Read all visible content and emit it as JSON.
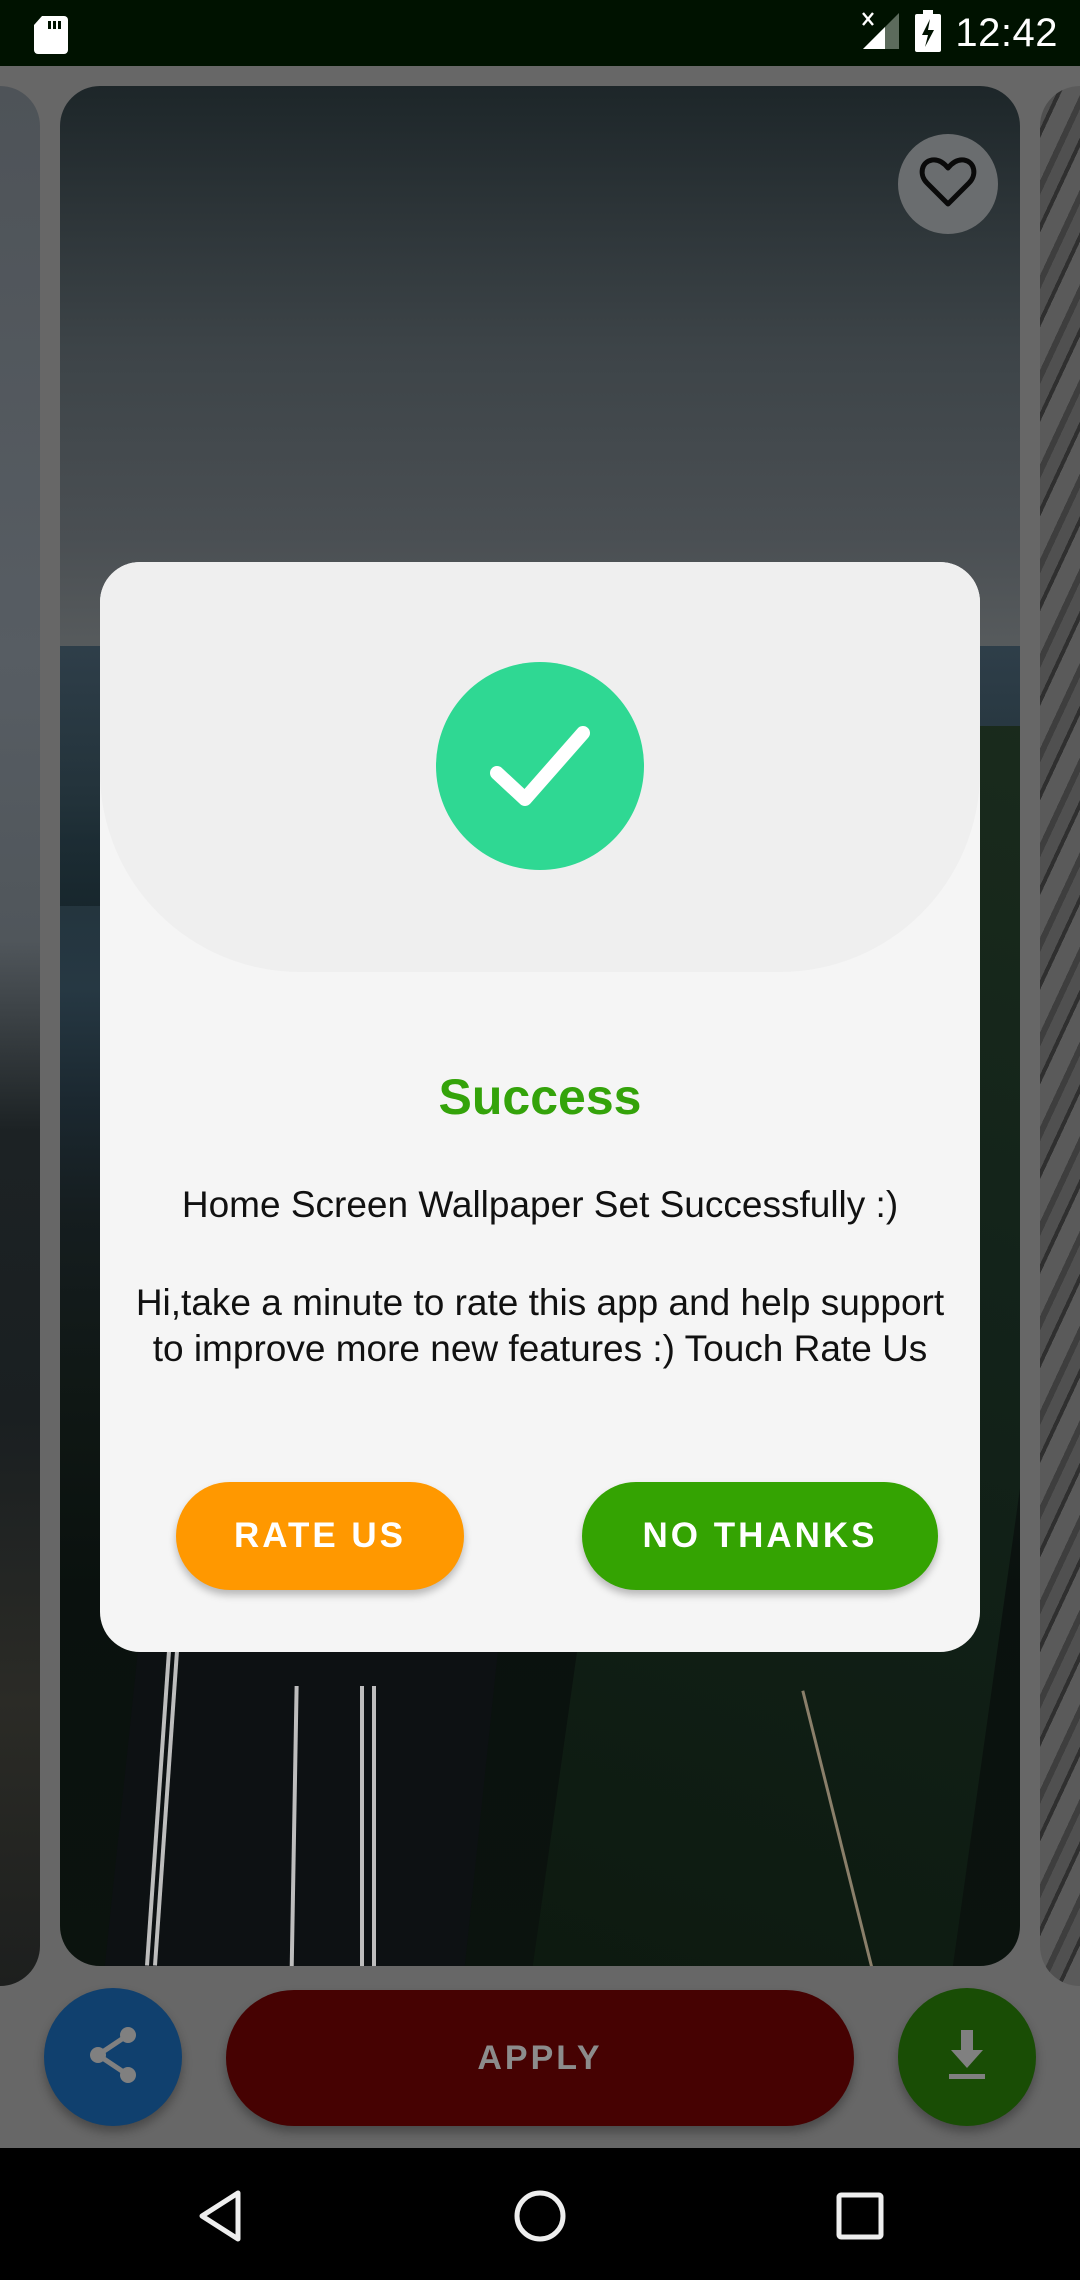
{
  "status_bar": {
    "time": "12:42",
    "icons": [
      "sd-card-icon",
      "signal-no-service-icon",
      "battery-charging-icon"
    ]
  },
  "wallpaper_card": {
    "favorite_icon": "heart-outline-icon"
  },
  "actions": {
    "share_icon": "share-icon",
    "apply_label": "APPLY",
    "download_icon": "download-icon"
  },
  "dialog": {
    "icon": "check-circle-icon",
    "title": "Success",
    "message": "Home Screen Wallpaper Set Successfully :)",
    "prompt": "Hi,take a minute to rate this app and help support to improve more new features :) Touch Rate Us",
    "rate_button": "RATE US",
    "no_thanks_button": "NO THANKS",
    "colors": {
      "title": "#34a30a",
      "icon_bg": "#2fd893",
      "rate_button": "#ff9800",
      "no_thanks_button": "#34a302"
    }
  },
  "nav_bar": {
    "back": "back-icon",
    "home": "home-icon",
    "recents": "recents-icon"
  }
}
